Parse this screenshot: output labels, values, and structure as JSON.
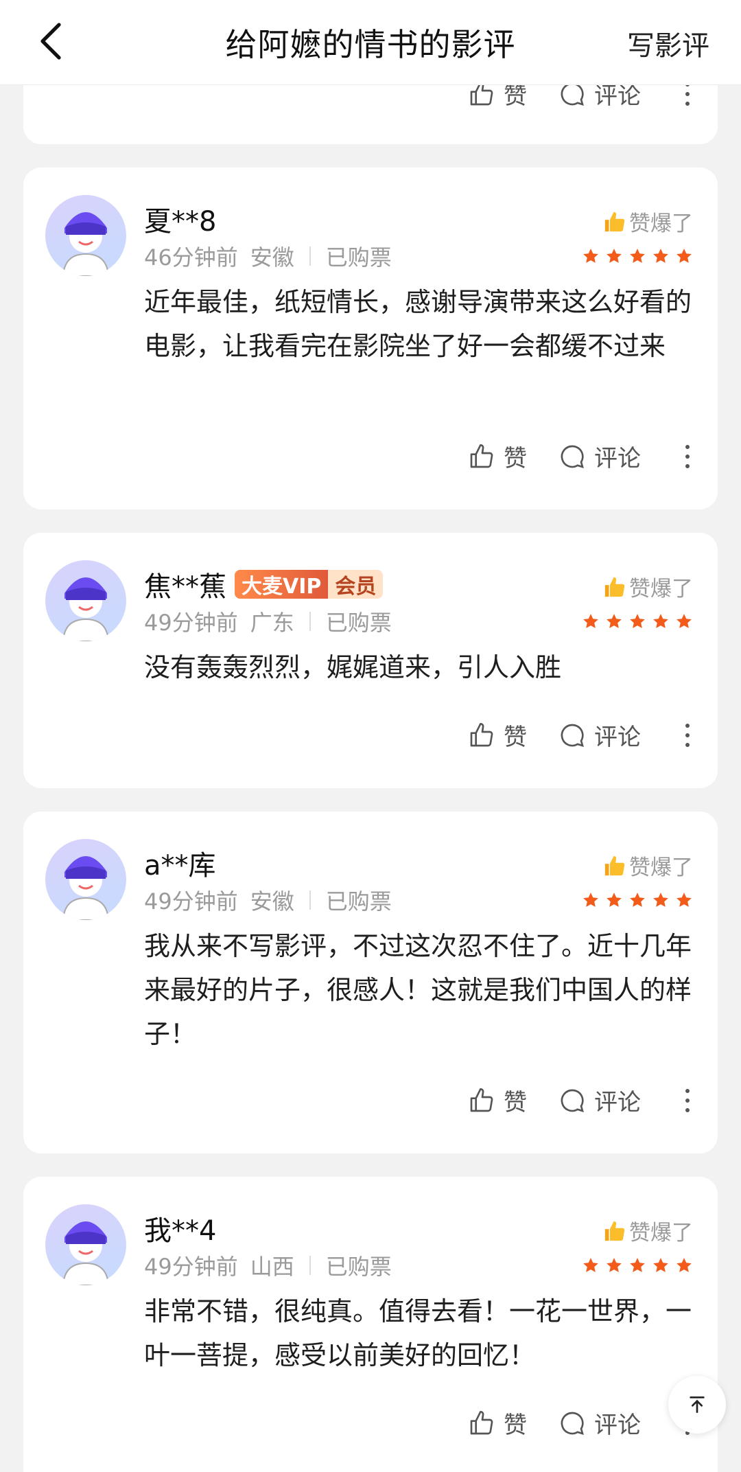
{
  "header": {
    "title": "给阿嬷的情书的影评",
    "write_label": "写影评"
  },
  "actions": {
    "like_label": "赞",
    "comment_label": "评论"
  },
  "hot_label": "赞爆了",
  "colors": {
    "star": "#f25b1a",
    "vip_orange": "#e96a3c"
  },
  "reviews": [
    {
      "user": "夏**8",
      "time": "46分钟前",
      "region": "安徽",
      "status": "已购票",
      "rating": 5,
      "text": "近年最佳，纸短情长，感谢导演带来这么好看的电影，让我看完在影院坐了好一会都缓不过来"
    },
    {
      "user": "焦**蕉",
      "vip_left": "大麦VIP",
      "vip_right": "会员",
      "time": "49分钟前",
      "region": "广东",
      "status": "已购票",
      "rating": 5,
      "text": "没有轰轰烈烈，娓娓道来，引人入胜"
    },
    {
      "user": "a**库",
      "time": "49分钟前",
      "region": "安徽",
      "status": "已购票",
      "rating": 5,
      "text": "我从来不写影评，不过这次忍不住了。近十几年来最好的片子，很感人！这就是我们中国人的样子！"
    },
    {
      "user": "我**4",
      "time": "49分钟前",
      "region": "山西",
      "status": "已购票",
      "rating": 5,
      "text": "非常不错，很纯真。值得去看！一花一世界，一叶一菩提，感受以前美好的回忆！"
    }
  ]
}
